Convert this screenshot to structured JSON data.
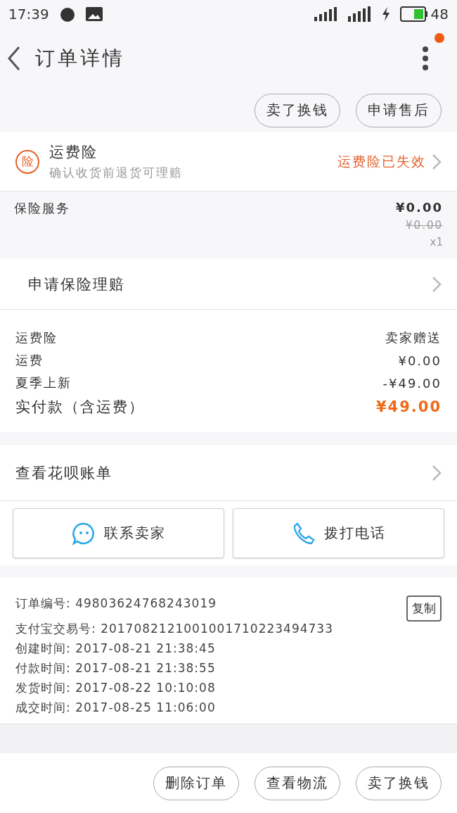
{
  "status_bar": {
    "time": "17:39",
    "battery_level": "48"
  },
  "header": {
    "title": "订单详情",
    "has_notification": true
  },
  "top_actions": [
    "卖了换钱",
    "申请售后"
  ],
  "insurance": {
    "badge": "险",
    "title": "运费险",
    "subtitle": "确认收货前退货可理赔",
    "status": "运费险已失效"
  },
  "service": {
    "name": "保险服务",
    "price": "¥0.00",
    "original_price": "¥0.00",
    "quantity": "x1"
  },
  "claim": {
    "label": "申请保险理赔"
  },
  "summary": [
    {
      "label": "运费险",
      "value": "卖家赠送",
      "kind": "normal"
    },
    {
      "label": "运费",
      "value": "¥0.00",
      "kind": "normal"
    },
    {
      "label": "夏季上新",
      "value": "-¥49.00",
      "kind": "normal"
    },
    {
      "label": "实付款（含运费）",
      "value": "¥49.00",
      "kind": "total"
    }
  ],
  "huabei": {
    "label": "查看花呗账单"
  },
  "contact_buttons": [
    {
      "label": "联系卖家",
      "kind": "chat"
    },
    {
      "label": "拨打电话",
      "kind": "phone"
    }
  ],
  "order_info": [
    {
      "label": "订单编号:",
      "value": "49803624768243019"
    },
    {
      "label": "支付宝交易号:",
      "value": "2017082121001001710223494733"
    },
    {
      "label": "创建时间:",
      "value": "2017-08-21  21:38:45"
    },
    {
      "label": "付款时间:",
      "value": "2017-08-21  21:38:55"
    },
    {
      "label": "发货时间:",
      "value": "2017-08-22  10:10:08"
    },
    {
      "label": "成交时间:",
      "value": "2017-08-25  11:06:00"
    }
  ],
  "copy_button": "复制",
  "bottom_actions": [
    "删除订单",
    "查看物流",
    "卖了换钱"
  ]
}
